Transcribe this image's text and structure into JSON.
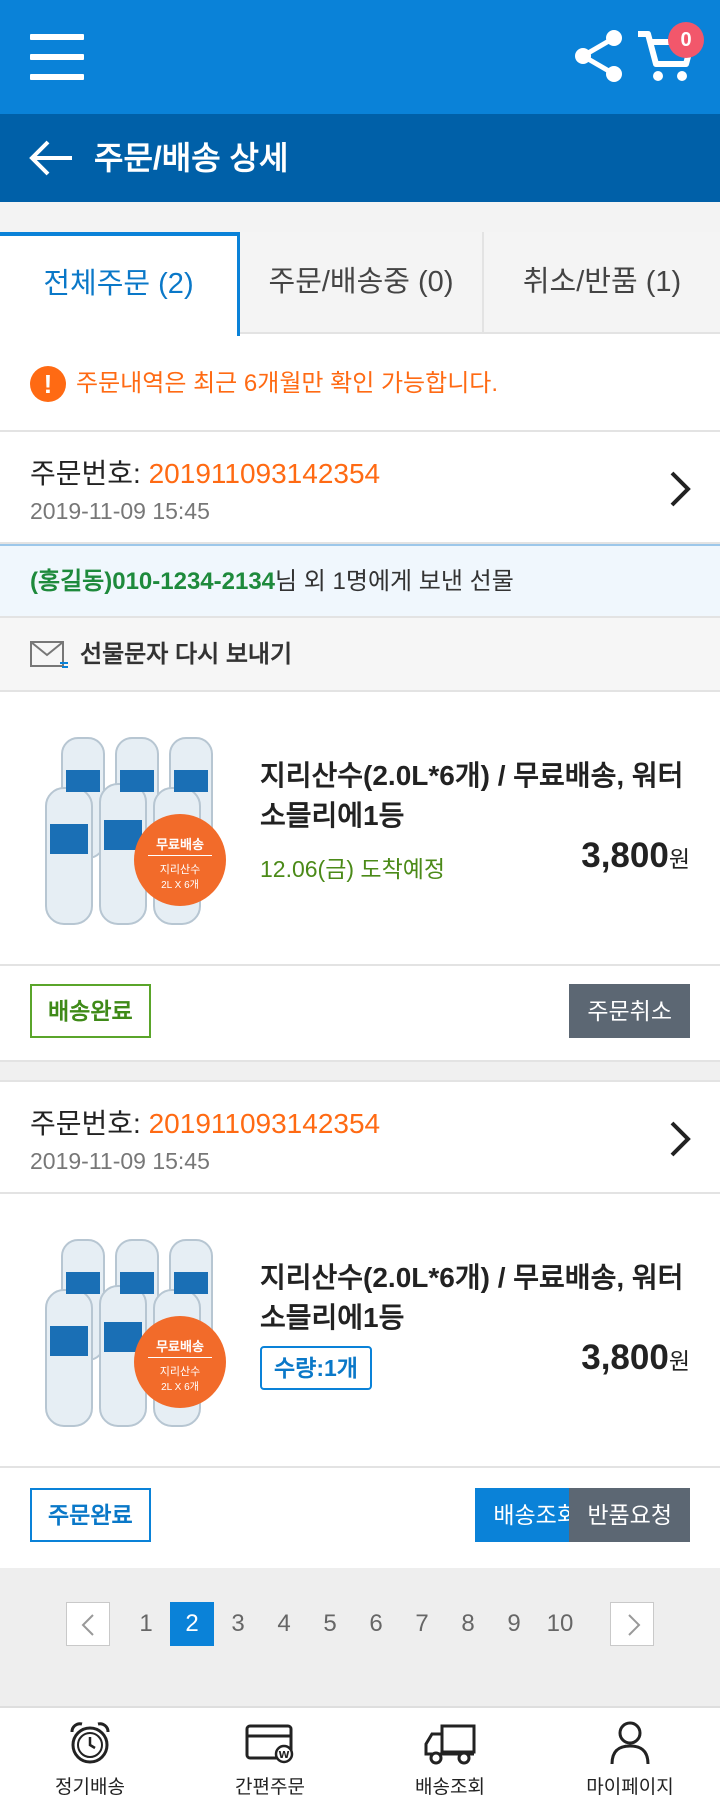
{
  "header": {
    "cart_count": "0",
    "title": "주문/배송 상세"
  },
  "tabs": [
    {
      "label": "전체주문 (2)"
    },
    {
      "label": "주문/배송중 (0)"
    },
    {
      "label": "취소/반품 (1)"
    }
  ],
  "notice": {
    "icon_glyph": "!",
    "text": "주문내역은 최근 6개월만 확인 가능합니다."
  },
  "orders": [
    {
      "no_label": "주문번호: ",
      "no": "201911093142354",
      "date": "2019-11-09 15:45",
      "gift_name": "(홍길동)010-1234-2134",
      "gift_rest": "님 외 1명에게 보낸 선물",
      "resend_label": "선물문자 다시 보내기",
      "product_name": "지리산수(2.0L*6개) / 무료배송, 워터 소믈리에1등",
      "arrival": "12.06(금) 도착예정",
      "price": "3,800",
      "currency": "원",
      "badge_title": "무료배송",
      "badge_line1": "지리산수",
      "badge_line2": "2L X 6개",
      "status": "배송완료",
      "action1": "주문취소"
    },
    {
      "no_label": "주문번호: ",
      "no": "201911093142354",
      "date": "2019-11-09 15:45",
      "product_name": "지리산수(2.0L*6개) / 무료배송, 워터 소믈리에1등",
      "qty": "수량:1개",
      "price": "3,800",
      "currency": "원",
      "badge_title": "무료배송",
      "badge_line1": "지리산수",
      "badge_line2": "2L X 6개",
      "status": "주문완료",
      "action1": "배송조회",
      "action2": "반품요청"
    }
  ],
  "pagination": {
    "pages": [
      "1",
      "2",
      "3",
      "4",
      "5",
      "6",
      "7",
      "8",
      "9",
      "10"
    ],
    "current": 2
  },
  "bottom_nav": [
    {
      "label": "정기배송",
      "icon": "alarm-clock-icon"
    },
    {
      "label": "간편주문",
      "icon": "card-icon"
    },
    {
      "label": "배송조회",
      "icon": "truck-icon"
    },
    {
      "label": "마이페이지",
      "icon": "person-icon"
    }
  ],
  "colors": {
    "primary": "#0a82d8",
    "primary_dark": "#0060a8",
    "accent_orange": "#ff6a13",
    "green": "#3f8a18",
    "badge_red": "#f2576b"
  }
}
